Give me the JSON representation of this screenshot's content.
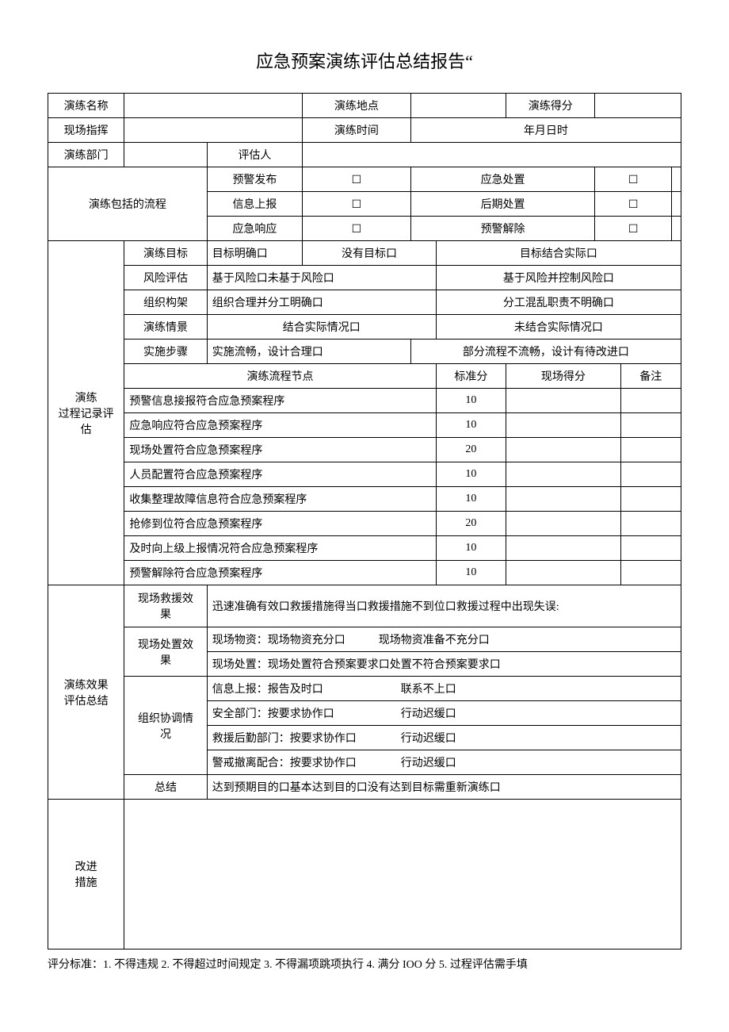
{
  "title": "应急预案演练评估总结报告“",
  "labels": {
    "exercise_name": "演练名称",
    "exercise_location": "演练地点",
    "exercise_score": "演练得分",
    "site_commander": "现场指挥",
    "exercise_time": "演练时间",
    "time_value": "年月日时",
    "exercise_dept": "演练部门",
    "evaluator": "评估人",
    "process_included": "演练包括的流程",
    "process_eval": "演练\n过程记录评\n估",
    "effect_eval": "演练效果\n评估总结",
    "improve": "改进\n措施"
  },
  "proc": {
    "r1a": "预警发布",
    "r1b": "应急处置",
    "r2a": "信息上报",
    "r2b": "后期处置",
    "r3a": "应急响应",
    "r3b": "预警解除",
    "box": "☐"
  },
  "sec1": {
    "goal_label": "演练目标",
    "goal_opts": {
      "a": "目标明确口",
      "b": "没有目标口",
      "c": "目标结合实际口"
    },
    "risk_label": "风险评估",
    "risk_opts": {
      "a": "基于风险口未基于风险口",
      "b": "基于风险并控制风险口"
    },
    "org_label": "组织构架",
    "org_opts": {
      "a": "组织合理并分工明确口",
      "b": "分工混乱职责不明确口"
    },
    "scene_label": "演练情景",
    "scene_opts": {
      "a": "结合实际情况口",
      "b": "未结合实际情况口"
    },
    "step_label": "实施步骤",
    "step_opts": {
      "a": "实施流畅，设计合理口",
      "b": "部分流程不流畅，设计有待改进口"
    }
  },
  "nodes": {
    "header": {
      "name": "演练流程节点",
      "std": "标准分",
      "site": "现场得分",
      "remark": "备注"
    },
    "rows": [
      {
        "name": "预警信息接报符合应急预案程序",
        "std": "10"
      },
      {
        "name": "应急响应符合应急预案程序",
        "std": "10"
      },
      {
        "name": "现场处置符合应急预案程序",
        "std": "20"
      },
      {
        "name": "人员配置符合应急预案程序",
        "std": "10"
      },
      {
        "name": "收集整理故障信息符合应急预案程序",
        "std": "10"
      },
      {
        "name": "抢修到位符合应急预案程序",
        "std": "20"
      },
      {
        "name": "及时向上级上报情况符合应急预案程序",
        "std": "10"
      },
      {
        "name": "预警解除符合应急预案程序",
        "std": "10"
      }
    ]
  },
  "effect": {
    "rescue_label": "现场救援效\n果",
    "rescue_text": "迅速准确有效口救援措施得当口救援措施不到位口救援过程中出现失误:",
    "disp_label": "现场处置效\n果",
    "disp_line1": "现场物资：现场物资充分口　　　现场物资准备不充分口",
    "disp_line2": "现场处置：现场处置符合预案要求口处置不符合预案要求口",
    "coord_label": "组织协调情\n况",
    "coord_line1": "信息上报：报告及时口　　　　　　　联系不上口",
    "coord_line2": "安全部门：按要求协作口　　　　　　行动迟缓口",
    "coord_line3": "救援后勤部门：按要求协作口　　　　行动迟缓口",
    "coord_line4": "警戒撤离配合：按要求协作口　　　　行动迟缓口",
    "summary_label": "总结",
    "summary_text": "达到预期目的口基本达到目的口没有达到目标需重新演练口"
  },
  "footnote": "评分标准：1. 不得违规 2. 不得超过时间规定 3. 不得漏项跳项执行 4. 满分 IOO 分 5. 过程评估需手填"
}
